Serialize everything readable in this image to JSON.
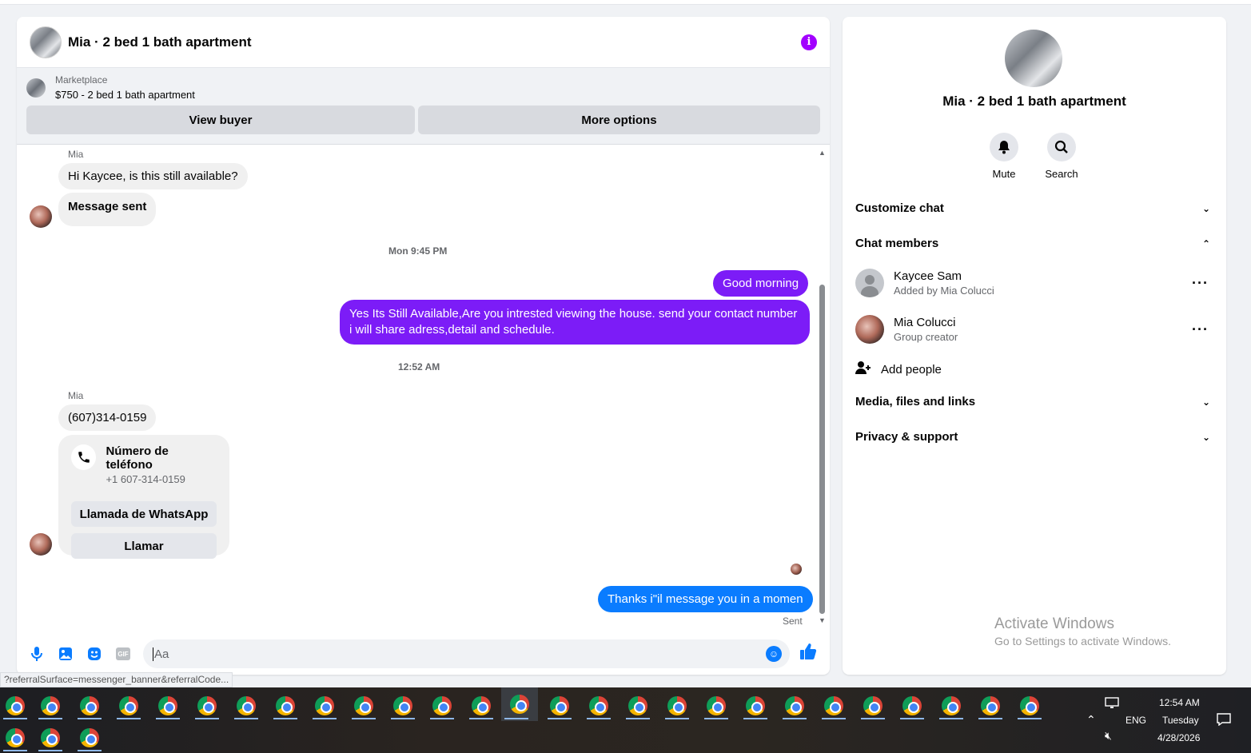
{
  "chat": {
    "title": "Mia · 2 bed 1 bath apartment",
    "info_icon": "i",
    "marketplace": {
      "label": "Marketplace",
      "listing": "$750 - 2 bed 1 bath apartment",
      "view_buyer": "View buyer",
      "more_options": "More options"
    },
    "messages": {
      "sender1": "Mia",
      "msg1": "Hi Kaycee, is this still available?",
      "msg2": "Message sent",
      "time1": "Mon 9:45 PM",
      "out1": "Good morning",
      "out2": "Yes Its Still Available,Are you intrested viewing the house. send your contact number i will share adress,detail and schedule.",
      "time2": "12:52 AM",
      "sender2": "Mia",
      "msg3": "(607)314-0159",
      "phone_card": {
        "title": "Número de teléfono",
        "number": "+1 607-314-0159",
        "whatsapp": "Llamada de WhatsApp",
        "call": "Llamar"
      },
      "out3": "Thanks i\"il message you in a momen",
      "sent_label": "Sent"
    },
    "composer": {
      "placeholder": "Aa",
      "gif": "GIF"
    }
  },
  "side": {
    "title": "Mia · 2 bed 1 bath apartment",
    "mute": "Mute",
    "search": "Search",
    "customize": "Customize chat",
    "members_header": "Chat members",
    "members": [
      {
        "name": "Kaycee Sam",
        "sub": "Added by Mia Colucci"
      },
      {
        "name": "Mia Colucci",
        "sub": "Group creator"
      }
    ],
    "add_people": "Add people",
    "media": "Media, files and links",
    "privacy": "Privacy & support"
  },
  "watermark": {
    "line1": "Activate Windows",
    "line2": "Go to Settings to activate Windows."
  },
  "status_url": "?referralSurface=messenger_banner&referralCode...",
  "taskbar": {
    "time": "12:54 AM",
    "day": "Tuesday",
    "date": "4/28/2026",
    "lang": "ENG"
  },
  "colors": {
    "accent_purple": "#7c1cf7",
    "accent_blue": "#0a7cff",
    "info_purple": "#a200ff"
  }
}
